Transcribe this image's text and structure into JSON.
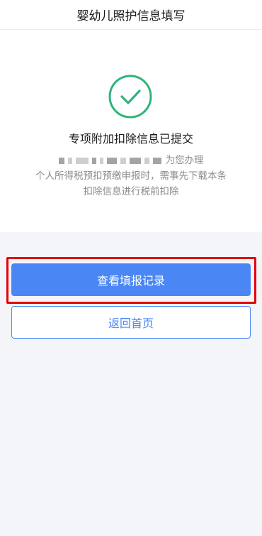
{
  "header": {
    "title": "婴幼儿照护信息填写"
  },
  "result": {
    "icon": "check-circle-icon",
    "icon_color": "#2fb47c",
    "title": "专项附加扣除信息已提交",
    "desc_line1_tail": "为您办理",
    "desc_line2": "个人所得税预扣预缴申报时，需事先下载本条",
    "desc_line3": "扣除信息进行税前扣除"
  },
  "actions": {
    "primary_label": "查看填报记录",
    "secondary_label": "返回首页"
  },
  "colors": {
    "primary": "#4a87f4",
    "highlight": "#e6000b",
    "background": "#f4f5f9"
  }
}
